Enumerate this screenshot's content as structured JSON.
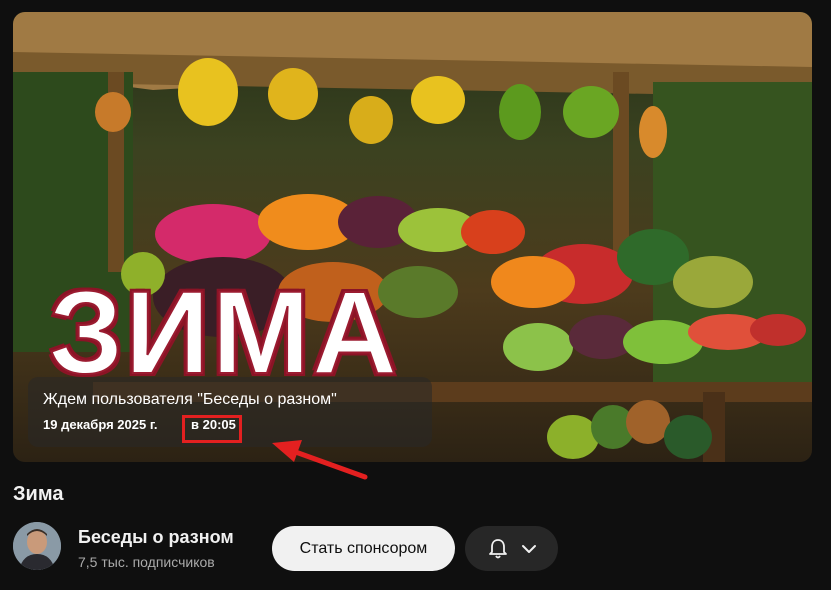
{
  "player": {
    "overlay_title": "ЗИМА",
    "premiere": {
      "waiting_text": "Ждем пользователя \"Беседы о разном\"",
      "date": "19 декабря 2025 г.",
      "time": "в 20:05"
    }
  },
  "video": {
    "title": "Зима"
  },
  "channel": {
    "name": "Беседы о разном",
    "subscribers": "7,5 тыс. подписчиков"
  },
  "actions": {
    "sponsor_label": "Стать спонсором",
    "bell_icon": "bell-icon",
    "chevron_icon": "chevron-down-icon"
  },
  "colors": {
    "background": "#0f0f0f",
    "annotation_red": "#e32020",
    "sponsor_button_bg": "#f1f1f1",
    "bell_button_bg": "#272727"
  }
}
